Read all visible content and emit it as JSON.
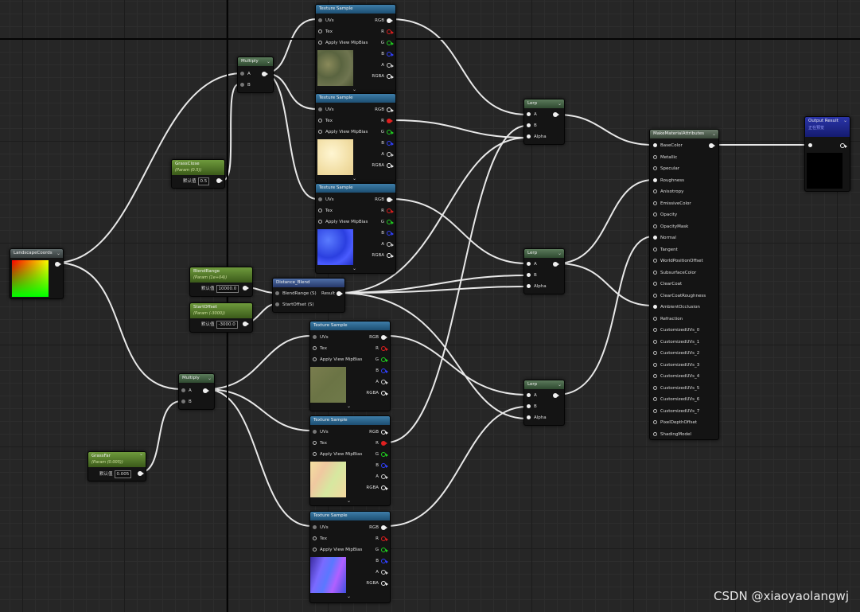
{
  "texture_sample": {
    "title": "Texture Sample",
    "inputs": [
      "UVs",
      "Tex",
      "Apply View MipBias"
    ],
    "outputs": [
      "RGB",
      "R",
      "G",
      "B",
      "A",
      "RGBA"
    ]
  },
  "multiply_title": "Multiply",
  "lerp": {
    "title": "Lerp",
    "inputs": [
      "A",
      "B",
      "Alpha"
    ]
  },
  "pin_a": "A",
  "pin_b": "B",
  "landscape_coords": {
    "title": "LandscapeCoords"
  },
  "grass_close": {
    "title": "GrassClose",
    "subtitle": "(Param (0.5))",
    "default_label": "默认值",
    "default_value": "0.5"
  },
  "grass_far": {
    "title": "GrassFar",
    "subtitle": "(Param (0.005))",
    "default_label": "默认值",
    "default_value": "0.005"
  },
  "blend_range": {
    "title": "BlendRange",
    "subtitle": "(Param (1e+04))",
    "default_label": "默认值",
    "default_value": "10000.0"
  },
  "start_offset": {
    "title": "StartOffset",
    "subtitle": "(Param (-3000))",
    "default_label": "默认值",
    "default_value": "-3000.0"
  },
  "distance_blend": {
    "title": "Distance_Blend",
    "inputs": [
      "BlendRange (S)",
      "StartOffset (S)"
    ],
    "output": "Result"
  },
  "make_material_attributes": {
    "title": "MakeMaterialAttributes",
    "pins": [
      "BaseColor",
      "Metallic",
      "Specular",
      "Roughness",
      "Anisotropy",
      "EmissiveColor",
      "Opacity",
      "OpacityMask",
      "Normal",
      "Tangent",
      "WorldPositionOffset",
      "SubsurfaceColor",
      "ClearCoat",
      "ClearCoatRoughness",
      "AmbientOcclusion",
      "Refraction",
      "CustomizedUVs_0",
      "CustomizedUVs_1",
      "CustomizedUVs_2",
      "CustomizedUVs_3",
      "CustomizedUVs_4",
      "CustomizedUVs_5",
      "CustomizedUVs_6",
      "CustomizedUVs_7",
      "PixelDepthOffset",
      "ShadingModel"
    ]
  },
  "output_result": {
    "title": "Output Result",
    "subtitle": "正在预览"
  },
  "watermark": "CSDN @xiaoyaolangwj",
  "colors": {
    "wire": "#e8e8e8",
    "texture_header": "#2e6b95",
    "param_header": "#5a8a2a",
    "output_header": "#1f28a0"
  },
  "icons": [
    "expand-chevron-icon",
    "collapse-chevron-icon",
    "input-pin-icon",
    "output-pin-icon"
  ]
}
